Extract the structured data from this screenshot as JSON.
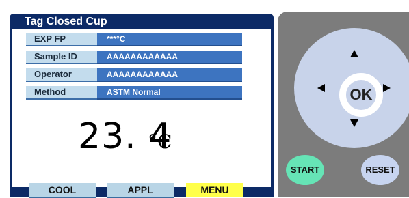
{
  "screen": {
    "title": "Tag Closed Cup",
    "fields": [
      {
        "label": "EXP FP",
        "value": "***°C"
      },
      {
        "label": "Sample ID",
        "value": "AAAAAAAAAAAA"
      },
      {
        "label": "Operator",
        "value": "AAAAAAAAAAAA"
      },
      {
        "label": "Method",
        "value": "ASTM Normal"
      }
    ],
    "temperature": "23. 4",
    "unit": "°C",
    "soft_buttons": {
      "cool": "COOL",
      "appl": "APPL",
      "menu": "MENU"
    }
  },
  "controls": {
    "ok": "OK",
    "start": "START",
    "reset": "RESET",
    "icons": [
      "arrow-up-icon",
      "arrow-down-icon",
      "arrow-left-icon",
      "arrow-right-icon"
    ]
  },
  "colors": {
    "screen_frame": "#0c2a66",
    "label_bg": "#c3dced",
    "value_bg": "#3d74c0",
    "menu_bg": "#ffff4a",
    "panel_bg": "#7c7c7c",
    "dpad_bg": "#c8d3ea",
    "start_bg": "#66e4b6",
    "reset_bg": "#c7d4f0"
  }
}
